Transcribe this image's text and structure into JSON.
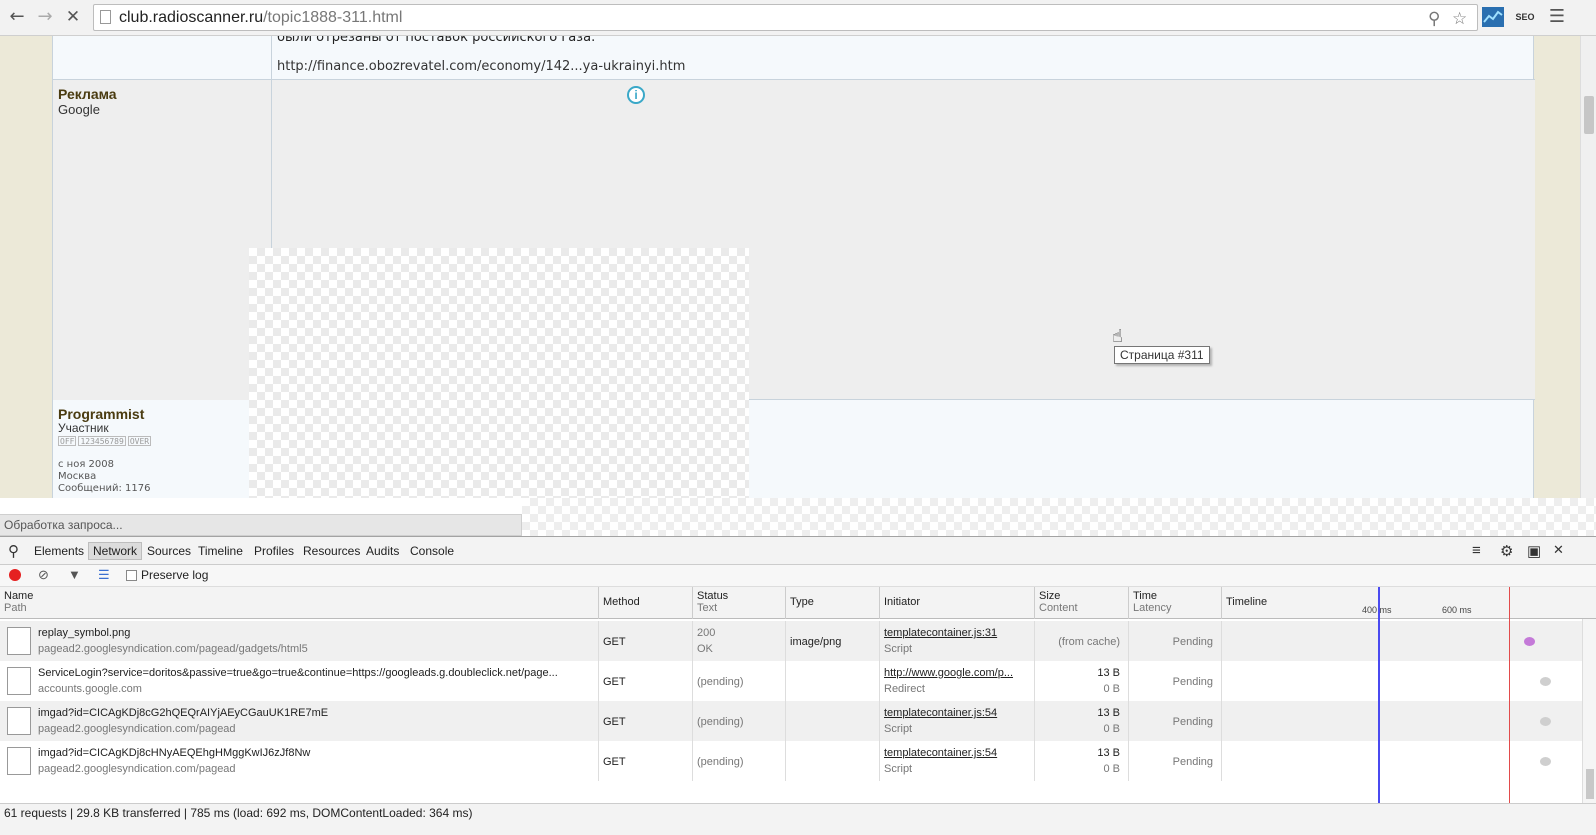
{
  "browser": {
    "url_domain": "club.radioscanner.ru",
    "url_path": "/topic1888-311.html",
    "ext_label": "SEO"
  },
  "page": {
    "clipped_text": "были отрезаны от поставок российского газа.",
    "post_link": "http://finance.obozrevatel.com/economy/142...ya-ukrainyi.htm",
    "ad_name": "Реклама",
    "ad_sub": "Google",
    "tooltip": "Страница #311",
    "user": {
      "name": "Programmist",
      "role": "Участник",
      "rank_off": "OFF",
      "rank_digits": "123456789",
      "rank_over": "OVER",
      "since": "с ноя 2008",
      "city": "Москва",
      "posts": "Сообщений: 1176"
    }
  },
  "status_bubble": "Обработка запроса...",
  "devtools": {
    "tabs": [
      "Elements",
      "Network",
      "Sources",
      "Timeline",
      "Profiles",
      "Resources",
      "Audits",
      "Console"
    ],
    "active_tab": "Network",
    "preserve_log": "Preserve log",
    "columns": {
      "name": "Name",
      "path": "Path",
      "method": "Method",
      "status": "Status",
      "text": "Text",
      "type": "Type",
      "initiator": "Initiator",
      "size": "Size",
      "content": "Content",
      "time": "Time",
      "latency": "Latency",
      "timeline": "Timeline"
    },
    "ticks": [
      "400 ms",
      "600 ms"
    ],
    "requests": [
      {
        "name": "replay_symbol.png",
        "path": "pagead2.googlesyndication.com/pagead/gadgets/html5",
        "method": "GET",
        "status": "200",
        "status_text": "OK",
        "type": "image/png",
        "initiator": "templatecontainer.js:31",
        "initiator_type": "Script",
        "size": "(from cache)",
        "content": "",
        "time": "Pending",
        "dot_color": "#c47ad8"
      },
      {
        "name": "ServiceLogin?service=doritos&passive=true&go=true&continue=https://googleads.g.doubleclick.net/page...",
        "path": "accounts.google.com",
        "method": "GET",
        "status": "(pending)",
        "status_text": "",
        "type": "",
        "initiator": "http://www.google.com/p...",
        "initiator_type": "Redirect",
        "size": "13 B",
        "content": "0 B",
        "time": "Pending",
        "dot_color": "#cfcfcf"
      },
      {
        "name": "imgad?id=CICAgKDj8cG2hQEQrAIYjAEyCGauUK1RE7mE",
        "path": "pagead2.googlesyndication.com/pagead",
        "method": "GET",
        "status": "(pending)",
        "status_text": "",
        "type": "",
        "initiator": "templatecontainer.js:54",
        "initiator_type": "Script",
        "size": "13 B",
        "content": "0 B",
        "time": "Pending",
        "dot_color": "#cfcfcf"
      },
      {
        "name": "imgad?id=CICAgKDj8cHNyAEQEhgHMggKwIJ6zJf8Nw",
        "path": "pagead2.googlesyndication.com/pagead",
        "method": "GET",
        "status": "(pending)",
        "status_text": "",
        "type": "",
        "initiator": "templatecontainer.js:54",
        "initiator_type": "Script",
        "size": "13 B",
        "content": "0 B",
        "time": "Pending",
        "dot_color": "#cfcfcf"
      }
    ],
    "summary": "61 requests | 29.8 KB transferred | 785 ms (load: 692 ms, DOMContentLoaded: 364 ms)"
  }
}
